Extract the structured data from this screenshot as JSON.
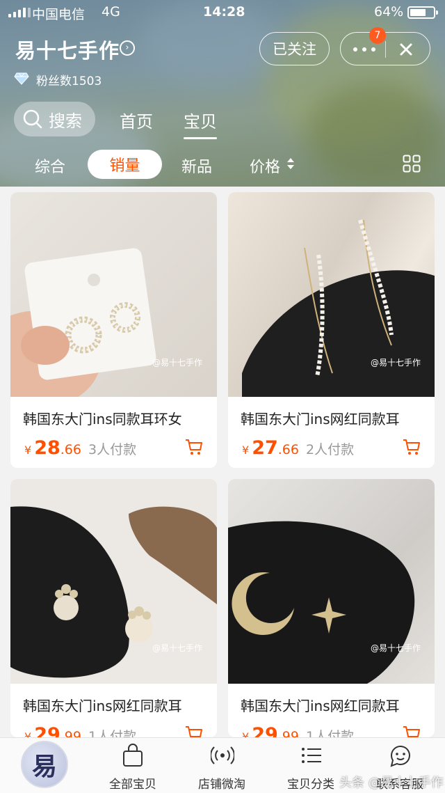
{
  "status_bar": {
    "carrier": "中国电信",
    "network": "4G",
    "time": "14:28",
    "battery": "64%"
  },
  "shop": {
    "name": "易十七手作",
    "fans": "粉丝数1503"
  },
  "header_actions": {
    "follow_label": "已关注",
    "notification_badge": "7"
  },
  "nav": {
    "search_label": "搜索",
    "home_label": "首页",
    "items_label": "宝贝"
  },
  "sort": {
    "overall": "综合",
    "sales": "销量",
    "new": "新品",
    "price": "价格"
  },
  "products": [
    {
      "title": "韩国东大门ins同款耳环女",
      "price_int": "28",
      "price_dec": ".66",
      "sold": "3人付款"
    },
    {
      "title": "韩国东大门ins网红同款耳",
      "price_int": "27",
      "price_dec": ".66",
      "sold": "2人付款"
    },
    {
      "title": "韩国东大门ins网红同款耳",
      "price_int": "29",
      "price_dec": ".99",
      "sold": "1人付款"
    },
    {
      "title": "韩国东大门ins网红同款耳",
      "price_int": "29",
      "price_dec": ".99",
      "sold": "1人付款"
    }
  ],
  "currency": "¥",
  "image_watermark": "@易十七手作",
  "bottom_tabs": {
    "logo_char": "易",
    "all_items": "全部宝贝",
    "weitao": "店铺微淘",
    "categories": "宝贝分类",
    "service": "联系客服"
  },
  "page_watermark": "头条 @易十七手作",
  "colors": {
    "accent": "#ff5000",
    "badge": "#ff5a1f"
  }
}
